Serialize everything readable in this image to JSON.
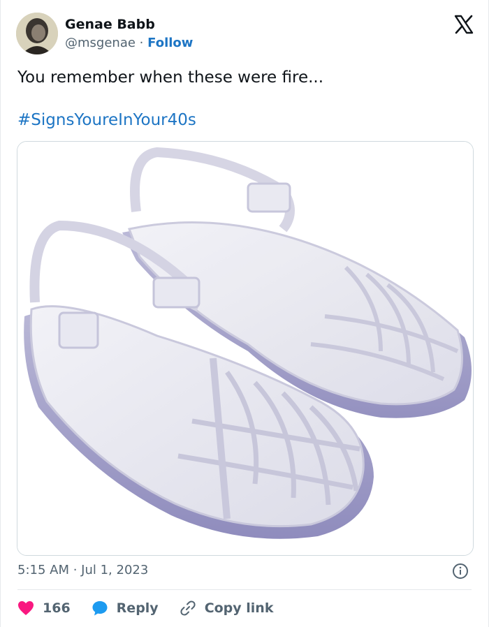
{
  "author": {
    "name": "Genae Babb",
    "handle": "@msgenae",
    "separator": "·",
    "follow_label": "Follow"
  },
  "tweet": {
    "text": "You remember when these were fire...",
    "hashtag": "#SignsYoureInYour40s",
    "timestamp": "5:15 AM · Jul 1, 2023"
  },
  "actions": {
    "likes": "166",
    "reply_label": "Reply",
    "copy_link_label": "Copy link"
  },
  "colors": {
    "link_blue": "#1d75c4",
    "like_pink": "#f91880",
    "reply_blue": "#1d9bf0",
    "muted": "#536471"
  },
  "icons": {
    "brand": "x-logo-icon",
    "info": "info-icon",
    "like": "heart-icon",
    "reply": "speech-bubble-icon",
    "copy_link": "link-icon"
  }
}
